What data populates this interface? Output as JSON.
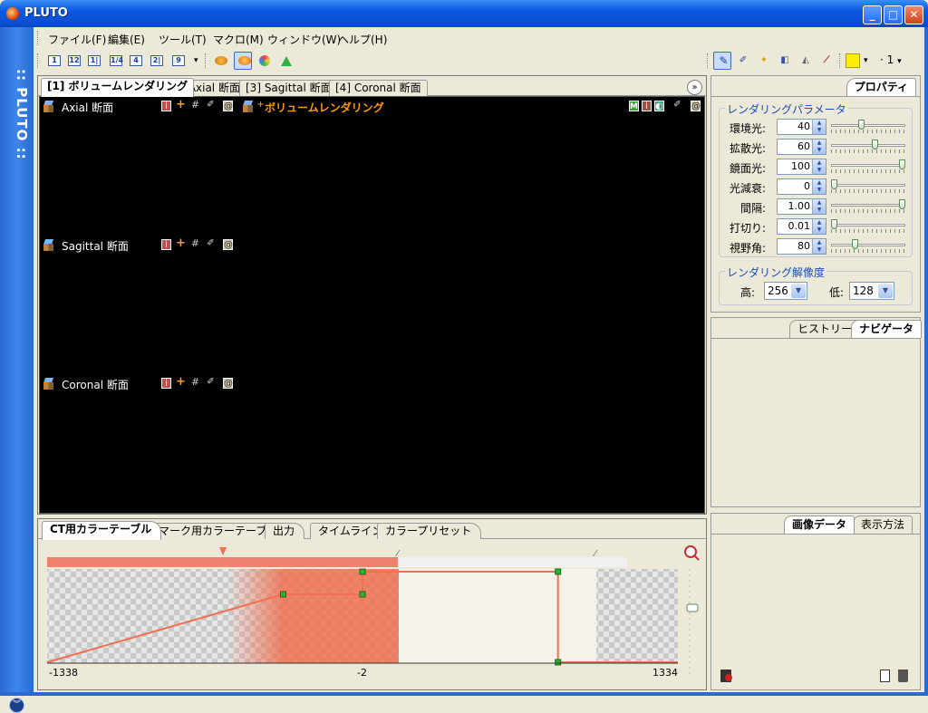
{
  "window": {
    "title": "PLUTO",
    "brand": "PLUTO"
  },
  "menu": [
    "ファイル(F)",
    "編集(E)",
    "ツール(T)",
    "マクロ(M)",
    "ウィンドウ(W)",
    "ヘルプ(H)"
  ],
  "toolbar_layout": [
    "1",
    "12",
    "1|",
    "1/4",
    "4",
    "2|",
    "9"
  ],
  "toolbar_right": {
    "page_indicator": "1"
  },
  "viewer_tabs": [
    "[1] ボリュームレンダリング",
    "[2] Axial 断面",
    "[3] Sagittal 断面",
    "[4] Coronal 断面"
  ],
  "viewports": {
    "axial": "Axial 断面",
    "sagittal": "Sagittal 断面",
    "coronal": "Coronal 断面",
    "volume": "ボリュームレンダリング"
  },
  "bottom_tabs": [
    "CT用カラーテーブル",
    "マーク用カラーテーブル",
    "出力",
    "タイムライン",
    "カラープリセット"
  ],
  "chart_data": {
    "type": "line",
    "x": [
      -1338,
      -338,
      -2,
      -2,
      826,
      826,
      1334
    ],
    "y": [
      0,
      0.75,
      0.75,
      1.0,
      1.0,
      0,
      0
    ],
    "xlim": [
      -1338,
      1334
    ],
    "ylim": [
      0,
      1
    ],
    "x_tick_labels": [
      "-1338",
      "-2",
      "1334"
    ],
    "color": "#f07050"
  },
  "properties": {
    "tab": "プロパティ",
    "render_group": "レンダリングパラメータ",
    "params": [
      {
        "label": "環境光:",
        "value": "40",
        "level": 0.4
      },
      {
        "label": "拡散光:",
        "value": "60",
        "level": 0.6
      },
      {
        "label": "鏡面光:",
        "value": "100",
        "level": 1.0
      },
      {
        "label": "光減衰:",
        "value": "0",
        "level": 0.0
      },
      {
        "label": "間隔:",
        "value": "1.00",
        "level": 1.0
      },
      {
        "label": "打切り:",
        "value": "0.01",
        "level": 0.0
      },
      {
        "label": "視野角:",
        "value": "80",
        "level": 0.3
      }
    ],
    "resolution_group": "レンダリング解像度",
    "high_label": "高:",
    "high_value": "256",
    "low_label": "低:",
    "low_value": "128"
  },
  "history_tabs": [
    "ヒストリー",
    "ナビゲータ"
  ],
  "data_tabs": [
    "画像データ",
    "表示方法"
  ]
}
